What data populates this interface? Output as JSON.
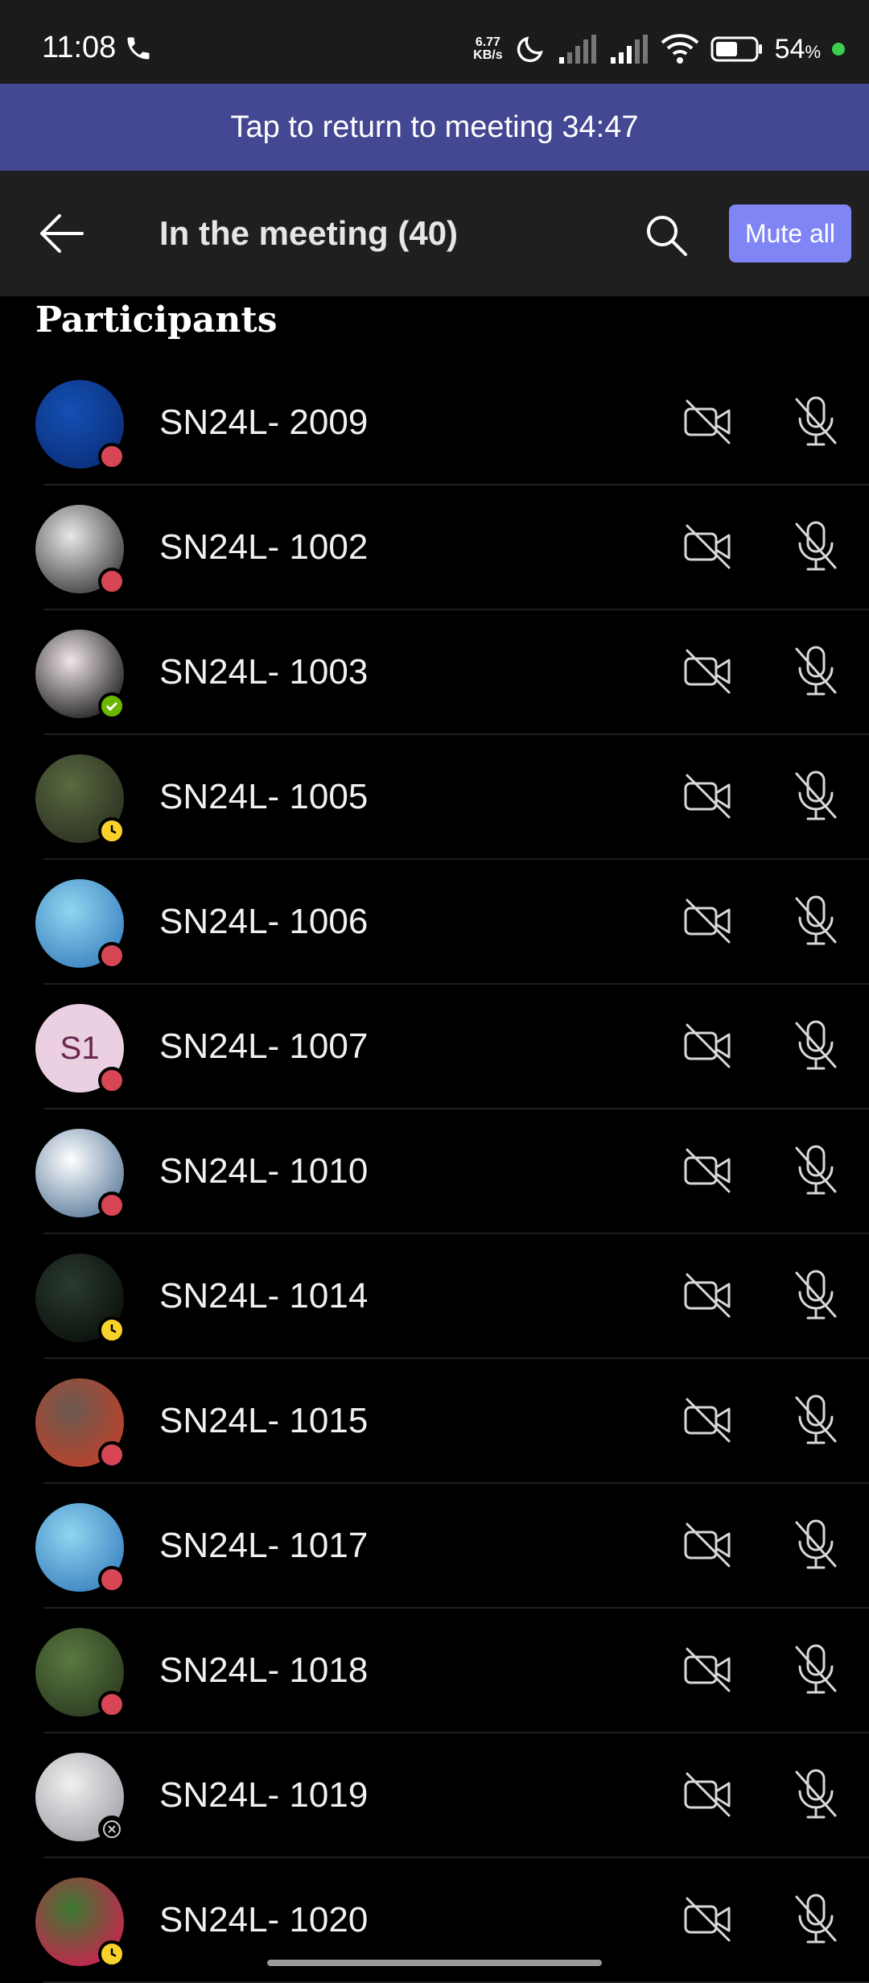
{
  "status_bar": {
    "time": "11:08",
    "speed_value": "6.77",
    "speed_unit": "KB/s",
    "battery": "54",
    "battery_unit": "%"
  },
  "banner": {
    "text": "Tap to return to meeting 34:47"
  },
  "header": {
    "title": "In the meeting (40)",
    "mute_all_label": "Mute all"
  },
  "section": {
    "title": "Participants"
  },
  "participants": [
    {
      "name": "SN24L- 2009",
      "presence": "busy",
      "avatar_colors": [
        "#1450b4",
        "#0a2e78"
      ]
    },
    {
      "name": "SN24L- 1002",
      "presence": "busy",
      "avatar_colors": [
        "#e8e8e8",
        "#3a3a3a"
      ]
    },
    {
      "name": "SN24L- 1003",
      "presence": "available",
      "avatar_colors": [
        "#f0e6ea",
        "#1a1a1a"
      ]
    },
    {
      "name": "SN24L- 1005",
      "presence": "away",
      "avatar_colors": [
        "#5a6a40",
        "#2a3020"
      ]
    },
    {
      "name": "SN24L- 1006",
      "presence": "busy",
      "avatar_colors": [
        "#8fd6f0",
        "#3a80c0"
      ]
    },
    {
      "name": "SN24L- 1007",
      "presence": "busy",
      "initials": "S1"
    },
    {
      "name": "SN24L- 1010",
      "presence": "busy",
      "avatar_colors": [
        "#ffffff",
        "#5a7a9a"
      ]
    },
    {
      "name": "SN24L- 1014",
      "presence": "away",
      "avatar_colors": [
        "#2a3a30",
        "#0a0f0a"
      ]
    },
    {
      "name": "SN24L- 1015",
      "presence": "busy",
      "avatar_colors": [
        "#6a5a50",
        "#c0402a"
      ]
    },
    {
      "name": "SN24L- 1017",
      "presence": "busy",
      "avatar_colors": [
        "#8fd6f0",
        "#3a80c0"
      ]
    },
    {
      "name": "SN24L- 1018",
      "presence": "busy",
      "avatar_colors": [
        "#5a7a40",
        "#2a3a20"
      ]
    },
    {
      "name": "SN24L- 1019",
      "presence": "offline",
      "avatar_colors": [
        "#f0f0f0",
        "#a0a0a8"
      ]
    },
    {
      "name": "SN24L- 1020",
      "presence": "away",
      "avatar_colors": [
        "#3a7a30",
        "#d02050"
      ]
    }
  ],
  "icons": {
    "camera": "camera-off-icon",
    "mic": "mic-off-icon",
    "back": "back-arrow-icon",
    "search": "search-icon"
  }
}
